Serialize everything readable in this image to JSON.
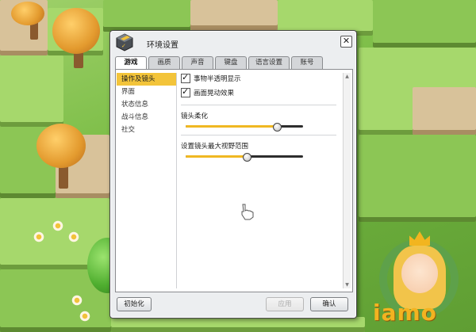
{
  "window": {
    "title": "环境设置",
    "close_glyph": "✕"
  },
  "tabs": [
    {
      "label": "游戏",
      "active": true
    },
    {
      "label": "画质",
      "active": false
    },
    {
      "label": "声音",
      "active": false
    },
    {
      "label": "键盘",
      "active": false
    },
    {
      "label": "语言设置",
      "active": false
    },
    {
      "label": "账号",
      "active": false
    }
  ],
  "sidebar": {
    "items": [
      {
        "label": "操作及镜头",
        "active": true
      },
      {
        "label": "界面",
        "active": false
      },
      {
        "label": "状态信息",
        "active": false
      },
      {
        "label": "战斗信息",
        "active": false
      },
      {
        "label": "社交",
        "active": false
      }
    ]
  },
  "options": {
    "translucent": {
      "label": "事物半透明显示",
      "checked": true
    },
    "screen_shake": {
      "label": "画面晃动效果",
      "checked": true
    }
  },
  "sliders": {
    "camera_smoothing": {
      "label": "镜头柔化",
      "value": 0.78
    },
    "camera_max_view": {
      "label": "设置镜头最大视野范围",
      "value": 0.52
    }
  },
  "buttons": {
    "init": "初始化",
    "apply": "应用",
    "ok": "确认"
  },
  "brand": {
    "logo_text": "iamo"
  },
  "colors": {
    "accent": "#f3c43a",
    "slider_fill": "#f0b822"
  }
}
